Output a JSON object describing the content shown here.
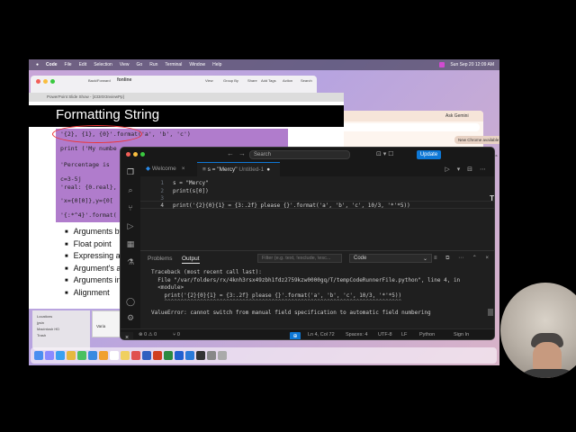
{
  "menubar": {
    "items": [
      "Code",
      "File",
      "Edit",
      "Selection",
      "View",
      "Go",
      "Run",
      "Terminal",
      "Window",
      "Help"
    ],
    "clock": "Sun Sep 20 12:09 AM"
  },
  "back_window": {
    "title": "PowerPoint Slide Show - [433r0r3nviewPp]",
    "labels": [
      "Back/Forward",
      "fonline",
      "View",
      "Group By",
      "Share",
      "Add Tags",
      "Action",
      "Search"
    ]
  },
  "chrome": {
    "ask_label": "Ask Gemini",
    "new_chrome": "New Chrome available",
    "bookmarks": "All Bookmarks"
  },
  "finder": {
    "section": "Locations",
    "items": [
      "jysin",
      "Macintosh HD",
      "Trash"
    ]
  },
  "slide": {
    "title": "Formatting String",
    "code_lines": [
      "'{2}, {1}, {0}'.format('a', 'b', 'c')",
      "print ('My numbe",
      "'Percentage is",
      "c=3-5j",
      "'real: {0.real},",
      "'x={0[0]},y={0[",
      "'{:*^4}'.format("
    ],
    "bullets": [
      "Arguments by",
      "Float point",
      "Expressing a p",
      "Argument's at",
      "Arguments in",
      "Alignment"
    ],
    "mini_label": "Varia"
  },
  "vscode": {
    "search_placeholder": "Search",
    "update_label": "Update",
    "tabs": {
      "welcome": "Welcome",
      "active_name": "s = \"Mercy\"",
      "active_sub": "Untitled-1",
      "modified_dot": "●"
    },
    "code": [
      {
        "ln": "1",
        "text": "s = \"Mercy\""
      },
      {
        "ln": "2",
        "text": "print(s[0])"
      },
      {
        "ln": "3",
        "text": ""
      },
      {
        "ln": "4",
        "text": "print('{2}{0}{1} = {3:.2f} please {}'.format('a', 'b', 'c', 10/3, '*'*5))"
      }
    ],
    "panel": {
      "tab_problems": "Problems",
      "tab_output": "Output",
      "filter_placeholder": "Filter (e.g. text, !exclude, \\esc...",
      "channel": "Code",
      "output_lines": [
        "Traceback (most recent call last):",
        "  File \"/var/folders/rx/4knh3rsx49zbh1fdz2759kzw0000gq/T/tempCodeRunnerFile.python\", line 4, in",
        "  <module>",
        "    print('{2}{0}{1} = {3:.2f} please {}'.format('a', 'b', 'c', 10/3, '*'*5))",
        "    ^^^^^^^^^^^^^^^^^^^^^^^^^^^^^^^^^^^^^^^^^^^^^^^^^^^^^^^^^^^^^^^^^^^^^^^^^",
        "ValueError: cannot switch from manual field specification to automatic field numbering"
      ]
    },
    "status": {
      "problems": "⊗ 0 ⚠ 0",
      "ports": "⑂ 0",
      "position": "Ln 4, Col 72",
      "spaces": "Spaces: 4",
      "encoding": "UTF-8",
      "eol": "LF",
      "language": "Python",
      "account": "Sign In"
    }
  }
}
